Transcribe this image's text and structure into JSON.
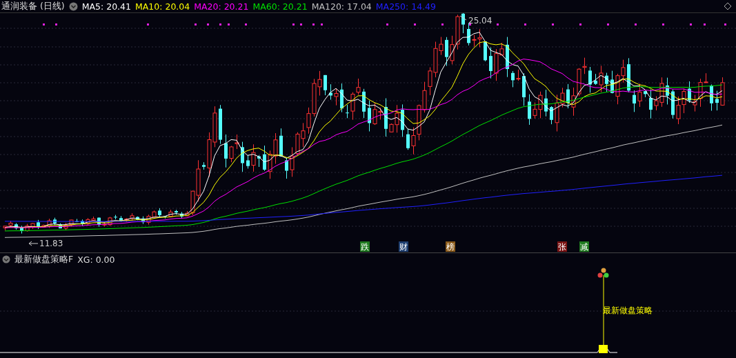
{
  "chart_header": {
    "title": "通润装备 (日线)",
    "moving_averages": [
      {
        "label": "MA5: 20.41",
        "color": "#ffffff"
      },
      {
        "label": "MA10: 20.04",
        "color": "#ffff00"
      },
      {
        "label": "MA20: 20.21",
        "color": "#ff00ff"
      },
      {
        "label": "MA60: 20.21",
        "color": "#00e000"
      },
      {
        "label": "MA120: 17.04",
        "color": "#c0c0c0"
      },
      {
        "label": "MA250: 14.49",
        "color": "#2020ff"
      }
    ]
  },
  "price_chart": {
    "high_label": "25.04",
    "low_label": "11.83",
    "event_markers": [
      {
        "label": "跌",
        "color": "#1f7a1f"
      },
      {
        "label": "财",
        "color": "#1f3f70"
      },
      {
        "label": "榜",
        "color": "#8a5a1a"
      },
      {
        "label": "张",
        "color": "#7a1414"
      },
      {
        "label": "减",
        "color": "#1f7a1f"
      }
    ]
  },
  "indicator_panel": {
    "title": "最新做盘策略F",
    "reading": "XG: 0.00",
    "signal_label": "最新做盘策略"
  }
}
